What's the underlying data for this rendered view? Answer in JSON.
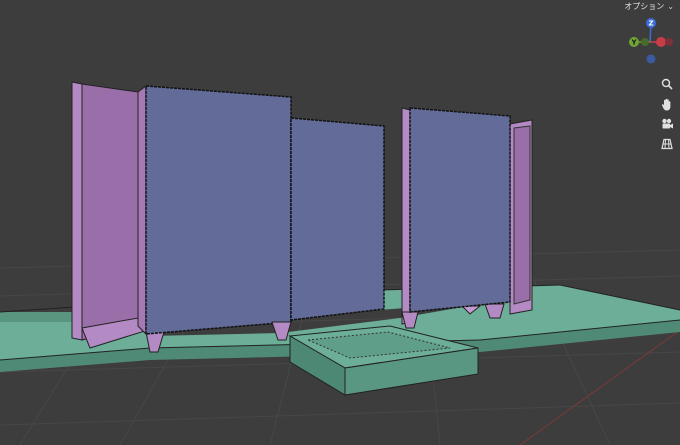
{
  "header": {
    "options_label": "オプション",
    "options_chevron": "chevron-down-icon"
  },
  "gizmo": {
    "z_label": "Z",
    "y_label": "Y",
    "colors": {
      "x": "#c93d49",
      "y": "#6fa535",
      "z": "#3c6cd8",
      "neg_z": "#3b5a9e",
      "neg_x": "#7d3038",
      "neg_y": "#4a6a2a"
    }
  },
  "nav_tools": [
    {
      "icon": "zoom-icon"
    },
    {
      "icon": "hand-pan-icon"
    },
    {
      "icon": "camera-icon"
    },
    {
      "icon": "grid-view-icon"
    }
  ],
  "scene": {
    "background": "#3d3d3d",
    "object_colors": {
      "frame": "#9a6ea8",
      "frame_light": "#b489c2",
      "panel": "#636b99",
      "base": "#5c9b86",
      "base_top": "#6fb39b"
    }
  }
}
